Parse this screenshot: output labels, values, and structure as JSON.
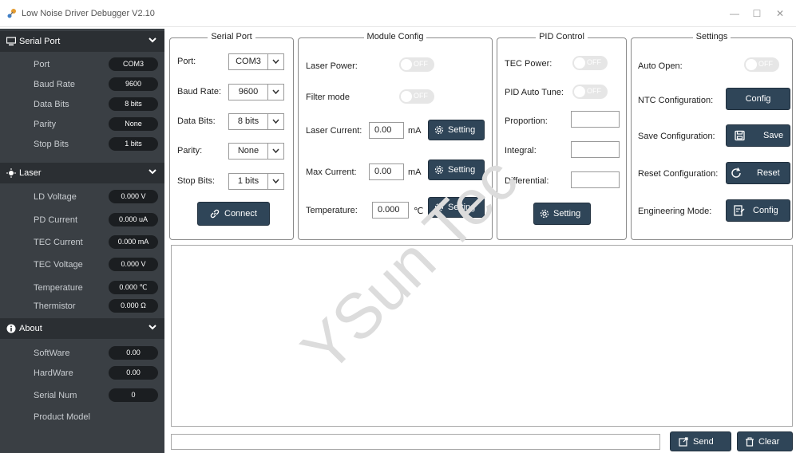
{
  "window": {
    "title": "Low Noise Driver Debugger V2.10",
    "minimize": "—",
    "maximize": "☐",
    "close": "✕"
  },
  "sidebar": {
    "serial": {
      "title": "Serial Port",
      "items": [
        {
          "label": "Port",
          "value": "COM3"
        },
        {
          "label": "Baud Rate",
          "value": "9600"
        },
        {
          "label": "Data Bits",
          "value": "8 bits"
        },
        {
          "label": "Parity",
          "value": "None"
        },
        {
          "label": "Stop Bits",
          "value": "1 bits"
        }
      ]
    },
    "laser": {
      "title": "Laser",
      "items": [
        {
          "label": "LD Voltage",
          "value": "0.000  V"
        },
        {
          "label": "PD Current",
          "value": "0.000 uA"
        },
        {
          "label": "TEC Current",
          "value": "0.000 mA"
        },
        {
          "label": "TEC Voltage",
          "value": "0.000  V"
        },
        {
          "label": "Temperature",
          "value": "0.000 ℃"
        },
        {
          "label": "Thermistor",
          "value": "0.000 Ω"
        }
      ]
    },
    "about": {
      "title": "About",
      "items": [
        {
          "label": "SoftWare",
          "value": "0.00"
        },
        {
          "label": "HardWare",
          "value": "0.00"
        },
        {
          "label": "Serial Num",
          "value": "0"
        },
        {
          "label": "Product Model",
          "value": ""
        }
      ]
    }
  },
  "serial_port": {
    "title": "Serial Port",
    "port_label": "Port:",
    "port_value": "COM3",
    "baud_label": "Baud Rate:",
    "baud_value": "9600",
    "data_label": "Data Bits:",
    "data_value": "8 bits",
    "parity_label": "Parity:",
    "parity_value": "None",
    "stop_label": "Stop Bits:",
    "stop_value": "1 bits",
    "connect": "Connect"
  },
  "module": {
    "title": "Module Config",
    "laser_power": "Laser Power:",
    "filter_mode": "Filter mode",
    "off": "OFF",
    "laser_current": "Laser Current:",
    "laser_current_value": "0.00",
    "laser_current_unit": "mA",
    "max_current": "Max Current:",
    "max_current_value": "0.00",
    "max_current_unit": "mA",
    "temperature": "Temperature:",
    "temperature_value": "0.000",
    "temperature_unit": "℃",
    "setting": "Setting"
  },
  "pid": {
    "title": "PID Control",
    "tec_power": "TEC Power:",
    "auto_tune": "PID Auto Tune:",
    "off": "OFF",
    "proportion": "Proportion:",
    "integral": "Integral:",
    "differential": "Differential:",
    "setting": "Setting"
  },
  "settings": {
    "title": "Settings",
    "auto_open": "Auto Open:",
    "off": "OFF",
    "ntc": "NTC Configuration:",
    "ntc_btn": "Config",
    "save": "Save Configuration:",
    "save_btn": "Save",
    "reset": "Reset Configuration:",
    "reset_btn": "Reset",
    "eng": "Engineering Mode:",
    "eng_btn": "Config"
  },
  "bottom": {
    "send": "Send",
    "clear": "Clear"
  },
  "watermark": "YSun Tec"
}
